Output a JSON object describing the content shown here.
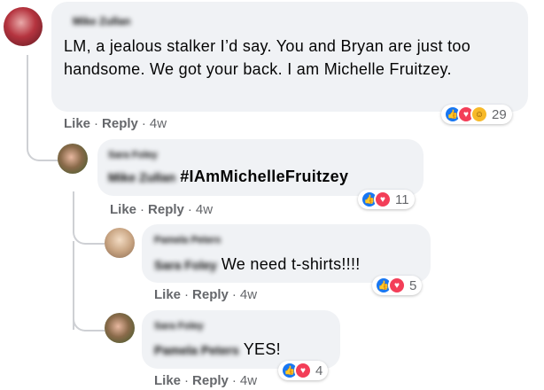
{
  "comments": [
    {
      "author": "Mike Zullan",
      "text": "LM, a jealous stalker I’d say. You and Bryan are just too handsome. We got your back. I am Michelle Fruitzey.",
      "like_label": "Like",
      "reply_label": "Reply",
      "time": "4w",
      "reaction_count": "29",
      "reaction_icons": [
        "like-icon",
        "love-icon",
        "haha-icon"
      ]
    },
    {
      "author": "Sara Foley",
      "mention": "Mike Zullan",
      "text": "#IAmMichelleFruitzey",
      "like_label": "Like",
      "reply_label": "Reply",
      "time": "4w",
      "reaction_count": "11",
      "reaction_icons": [
        "like-icon",
        "love-icon"
      ]
    },
    {
      "author": "Pamela Peters",
      "mention": "Sara Foley",
      "text": "We need t-shirts!!!!",
      "like_label": "Like",
      "reply_label": "Reply",
      "time": "4w",
      "reaction_count": "5",
      "reaction_icons": [
        "like-icon",
        "love-icon"
      ]
    },
    {
      "author": "Sara Foley",
      "mention": "Pamela Peters",
      "text": "YES!",
      "like_label": "Like",
      "reply_label": "Reply",
      "time": "4w",
      "reaction_count": "4",
      "reaction_icons": [
        "like-icon",
        "love-icon"
      ]
    }
  ],
  "colors": {
    "bubble": "#f0f2f5",
    "meta_text": "#65676b",
    "like_blue": "#1877f2",
    "love_red": "#f33e58",
    "haha_yellow": "#f7b928"
  }
}
